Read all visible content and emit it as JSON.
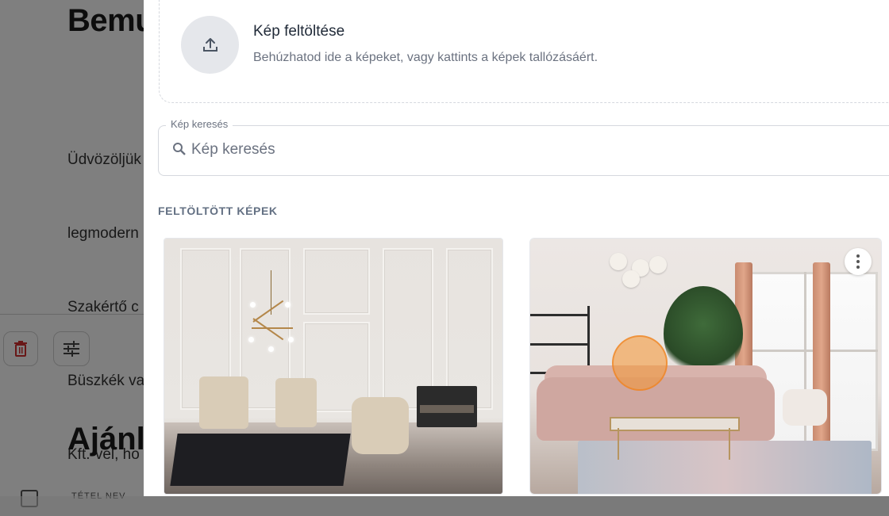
{
  "background_page": {
    "title": "Bemu",
    "paragraph_lines": [
      "Üdvözöljük",
      "legmodern",
      "Szakértő c",
      "Büszkék va",
      "Kft.-vel, ho"
    ],
    "heading2": "Ajánla",
    "small_text": "TÉTEL NEV"
  },
  "drawer": {
    "upload": {
      "title": "Kép feltöltése",
      "subtitle": "Behúzhatod ide a képeket, vagy kattints a képek tallózásáért."
    },
    "search": {
      "label": "Kép keresés",
      "placeholder": "Kép keresés"
    },
    "section_title": "FELTÖLTÖTT KÉPEK",
    "images": [
      {
        "name": "classic-room-image",
        "icon": "image"
      },
      {
        "name": "living-room-image",
        "icon": "image",
        "menu_icon": "more-vertical-icon"
      }
    ]
  },
  "colors": {
    "scrim": "#000000",
    "accent_cursor": "#f59632",
    "delete_red": "#d32f2f",
    "section_title": "#637083"
  }
}
